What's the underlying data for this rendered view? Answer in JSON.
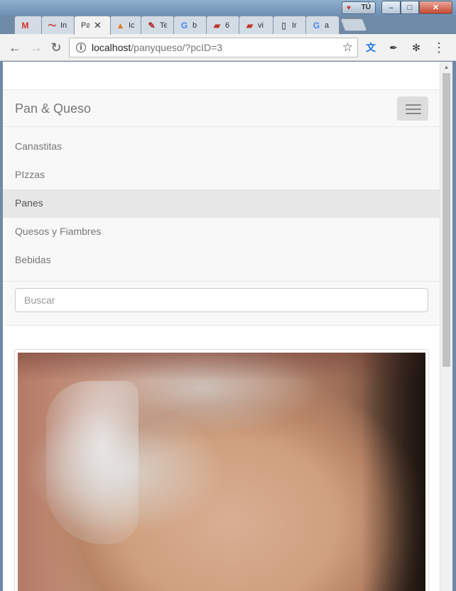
{
  "window": {
    "user_label": "TÚ",
    "controls": {
      "minimize": "–",
      "maximize": "□",
      "close": "✕"
    }
  },
  "tabs": [
    {
      "title": "",
      "icon": "gmail-icon",
      "glyph": "M",
      "color": "#d93025"
    },
    {
      "title": "In",
      "icon": "wave-icon",
      "glyph": "〜",
      "color": "#d0332d"
    },
    {
      "title": "Pa",
      "icon": "page-icon",
      "glyph": "",
      "color": "#333333",
      "active": true
    },
    {
      "title": "Ic",
      "icon": "pma-icon",
      "glyph": "▲",
      "color": "#e07a1a"
    },
    {
      "title": "Te",
      "icon": "translator-icon",
      "glyph": "✎",
      "color": "#b02a2a"
    },
    {
      "title": "b",
      "icon": "google-icon",
      "glyph": "G",
      "color": "#4285f4"
    },
    {
      "title": "6",
      "icon": "book-icon",
      "glyph": "▰",
      "color": "#c0392b"
    },
    {
      "title": "vi",
      "icon": "book-icon",
      "glyph": "▰",
      "color": "#c0392b"
    },
    {
      "title": "Ir",
      "icon": "document-icon",
      "glyph": "▯",
      "color": "#666666"
    },
    {
      "title": "a",
      "icon": "google-icon",
      "glyph": "G",
      "color": "#4285f4"
    }
  ],
  "toolbar": {
    "back": "←",
    "forward": "→",
    "reload": "↻",
    "url_host": "localhost",
    "url_path": "/panyqueso/?pcID=3",
    "bookmark": "☆",
    "menu": "⋮",
    "translate": "文",
    "eyedropper": "✒",
    "extension": "✻"
  },
  "site": {
    "brand": "Pan & Queso",
    "nav": [
      {
        "label": "Canastitas"
      },
      {
        "label": "PIzzas"
      },
      {
        "label": "Panes",
        "active": true
      },
      {
        "label": "Quesos y Fiambres"
      },
      {
        "label": "Bebidas"
      }
    ],
    "search_placeholder": "Buscar"
  },
  "colors": {
    "navbar_bg": "#f8f8f8",
    "active_item_bg": "#e7e7e7",
    "link_text": "#777777",
    "close_button": "#c4472f"
  }
}
